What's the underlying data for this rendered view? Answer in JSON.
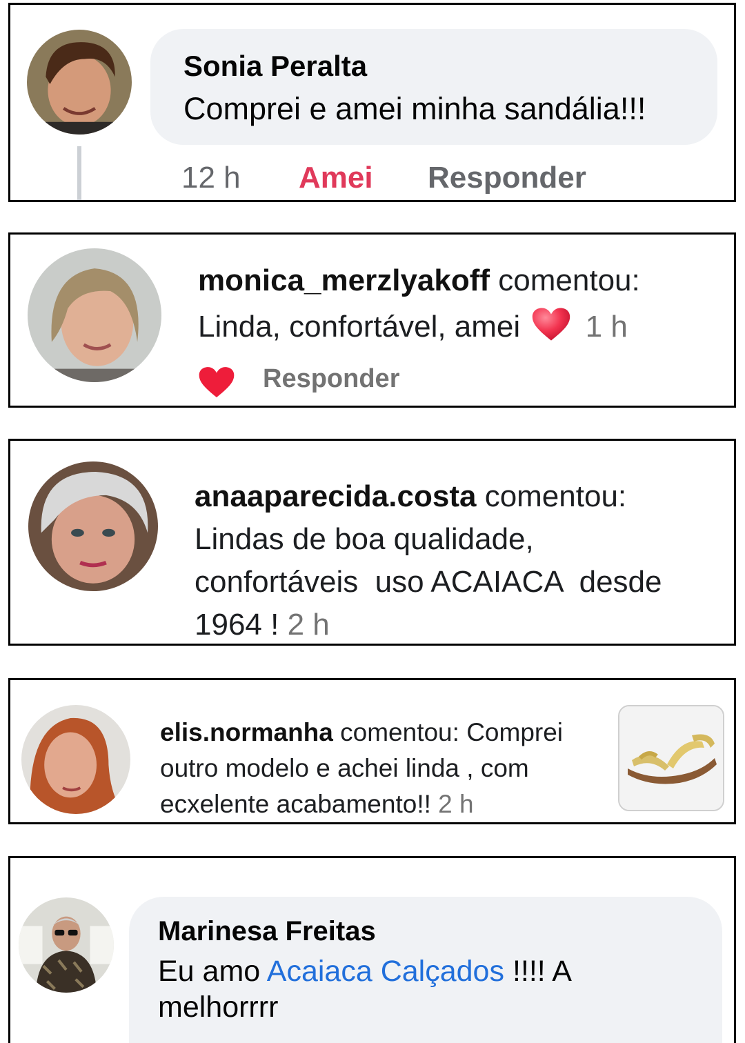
{
  "comments": [
    {
      "author": "Sonia Peralta",
      "text": "Comprei e amei minha sandália!!!",
      "time": "12 h",
      "reaction_label": "Amei",
      "reply_label": "Responder"
    },
    {
      "author": "monica_merzlyakoff",
      "verb": "comentou:",
      "text": "Linda, confortável, amei",
      "emoji": "red-heart",
      "time": "1 h",
      "reply_label": "Responder"
    },
    {
      "author": "anaaparecida.costa",
      "verb": "comentou:",
      "text_line1": "Lindas de boa qualidade,",
      "text_line2": "confortáveis  uso ACAIACA  desde",
      "text_line3": "1964 !",
      "time": "2 h"
    },
    {
      "author": "elis.normanha",
      "verb": "comentou:",
      "text": "Comprei outro modelo e achei linda , com ecxelente acabamento!!",
      "time": "2 h",
      "thumbnail": "gold-sandal"
    },
    {
      "author": "Marinesa Freitas",
      "text_before": "Eu amo",
      "mention": "Acaiaca Calçados",
      "text_after": "!!!! A melhorrrr"
    }
  ],
  "colors": {
    "bubble": "#f0f2f5",
    "love_reaction": "#e0395a",
    "link": "#216fdb",
    "heart": "#ee1d3a",
    "meta_grey": "#737373"
  }
}
